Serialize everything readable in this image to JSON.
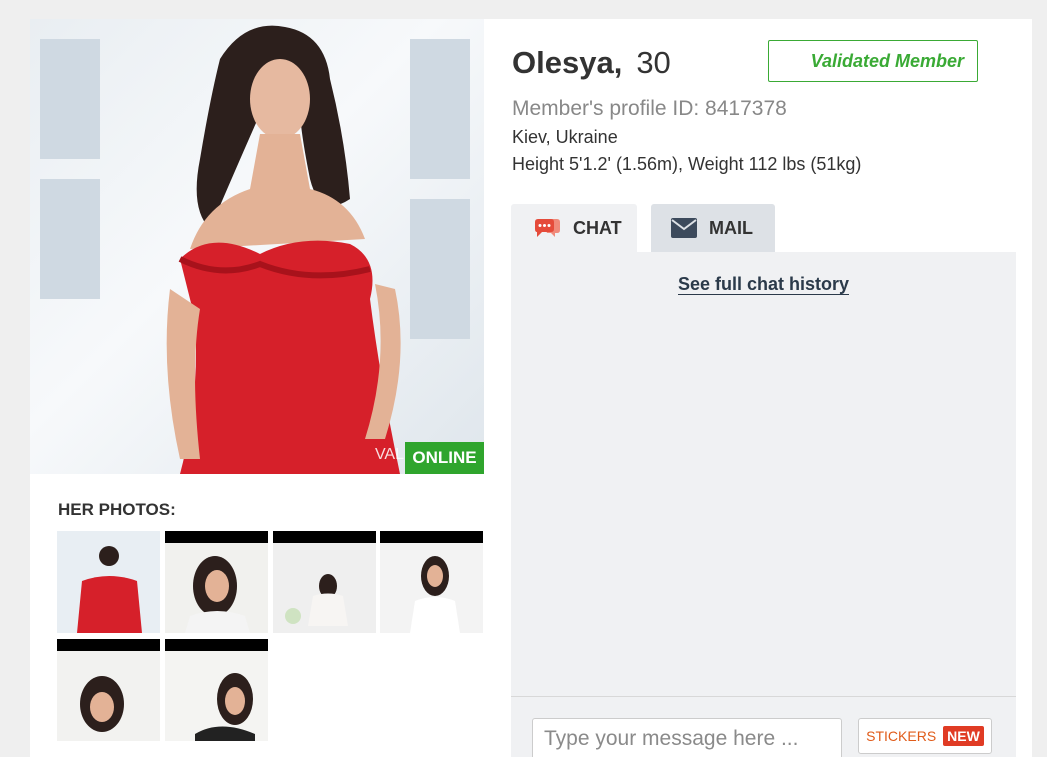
{
  "profile": {
    "name": "Olesya,",
    "age": "30",
    "validated_label": "Validated Member",
    "profile_id": "Member's profile ID: 8417378",
    "location": "Kiev, Ukraine",
    "stats": "Height 5'1.2' (1.56m), Weight 112 lbs (51kg)",
    "online_label": "ONLINE",
    "watermark": "VAL"
  },
  "photos": {
    "title": "HER PHOTOS:",
    "count": 6
  },
  "tabs": [
    {
      "label": "CHAT",
      "icon": "chat-bubbles-icon",
      "active": true
    },
    {
      "label": "MAIL",
      "icon": "envelope-icon",
      "active": false
    }
  ],
  "chat": {
    "history_link": "See full chat history",
    "input_placeholder": "Type your message here ...",
    "stickers_label": "STICKERS",
    "new_badge": "NEW"
  },
  "colors": {
    "online": "#2fa52d",
    "validated": "#3aaa35",
    "dress": "#d6202a",
    "new_badge": "#e03b24",
    "stickers_text": "#e05c1a"
  }
}
